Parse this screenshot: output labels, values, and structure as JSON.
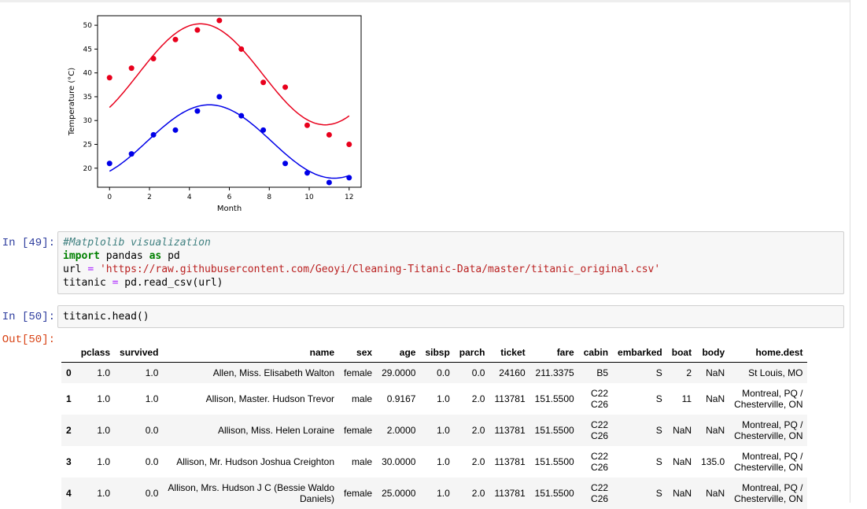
{
  "chart_data": {
    "type": "scatter",
    "xlabel": "Month",
    "ylabel": "Temperature (°C)",
    "xlim": [
      -0.6,
      12.6
    ],
    "ylim": [
      16,
      52
    ],
    "xticks": [
      0,
      2,
      4,
      6,
      8,
      10,
      12
    ],
    "yticks": [
      20,
      25,
      30,
      35,
      40,
      45,
      50
    ],
    "series": [
      {
        "color": "#e8001c",
        "x": [
          0,
          1.1,
          2.2,
          3.3,
          4.4,
          5.5,
          6.6,
          7.7,
          8.8,
          9.9,
          11,
          12
        ],
        "y": [
          39,
          41,
          43,
          47,
          49,
          51,
          45,
          38,
          37,
          29,
          27,
          25
        ],
        "fit": {
          "mean": 39.7,
          "amplitude": 10.6,
          "phase": 4.55,
          "period": 12.5
        }
      },
      {
        "color": "#0000e8",
        "x": [
          0,
          1.1,
          2.2,
          3.3,
          4.4,
          5.5,
          6.6,
          7.7,
          8.8,
          9.9,
          11,
          12
        ],
        "y": [
          21,
          23,
          27,
          28,
          32,
          35,
          31,
          28,
          21,
          19,
          17,
          18
        ],
        "fit": {
          "mean": 25.6,
          "amplitude": 7.7,
          "phase": 5.0,
          "period": 12.5
        }
      }
    ]
  },
  "cells": [
    {
      "prompt": "In [49]:",
      "lines": [
        [
          {
            "t": "#Matplolib visualization",
            "c": "c-com"
          }
        ],
        [
          {
            "t": "import",
            "c": "c-kw"
          },
          {
            "t": " pandas "
          },
          {
            "t": "as",
            "c": "c-kw"
          },
          {
            "t": " pd"
          }
        ],
        [
          {
            "t": "url "
          },
          {
            "t": "=",
            "c": "c-op"
          },
          {
            "t": " "
          },
          {
            "t": "'https://raw.githubusercontent.com/Geoyi/Cleaning-Titanic-Data/master/titanic_original.csv'",
            "c": "c-str"
          }
        ],
        [
          {
            "t": "titanic "
          },
          {
            "t": "=",
            "c": "c-op"
          },
          {
            "t": " pd.read_csv(url)"
          }
        ]
      ]
    },
    {
      "prompt": "In [50]:",
      "lines": [
        [
          {
            "t": "titanic.head()"
          }
        ]
      ]
    }
  ],
  "output_prompt": "Out[50]:",
  "dataframe": {
    "columns": [
      "",
      "pclass",
      "survived",
      "name",
      "sex",
      "age",
      "sibsp",
      "parch",
      "ticket",
      "fare",
      "cabin",
      "embarked",
      "boat",
      "body",
      "home.dest"
    ],
    "rows": [
      [
        "0",
        "1.0",
        "1.0",
        "Allen, Miss. Elisabeth Walton",
        "female",
        "29.0000",
        "0.0",
        "0.0",
        "24160",
        "211.3375",
        "B5",
        "S",
        "2",
        "NaN",
        "St Louis, MO"
      ],
      [
        "1",
        "1.0",
        "1.0",
        "Allison, Master. Hudson Trevor",
        "male",
        "0.9167",
        "1.0",
        "2.0",
        "113781",
        "151.5500",
        "C22\nC26",
        "S",
        "11",
        "NaN",
        "Montreal, PQ /\nChesterville, ON"
      ],
      [
        "2",
        "1.0",
        "0.0",
        "Allison, Miss. Helen Loraine",
        "female",
        "2.0000",
        "1.0",
        "2.0",
        "113781",
        "151.5500",
        "C22\nC26",
        "S",
        "NaN",
        "NaN",
        "Montreal, PQ /\nChesterville, ON"
      ],
      [
        "3",
        "1.0",
        "0.0",
        "Allison, Mr. Hudson Joshua Creighton",
        "male",
        "30.0000",
        "1.0",
        "2.0",
        "113781",
        "151.5500",
        "C22\nC26",
        "S",
        "NaN",
        "135.0",
        "Montreal, PQ /\nChesterville, ON"
      ],
      [
        "4",
        "1.0",
        "0.0",
        "Allison, Mrs. Hudson J C (Bessie Waldo\nDaniels)",
        "female",
        "25.0000",
        "1.0",
        "2.0",
        "113781",
        "151.5500",
        "C22\nC26",
        "S",
        "NaN",
        "NaN",
        "Montreal, PQ /\nChesterville, ON"
      ]
    ]
  }
}
